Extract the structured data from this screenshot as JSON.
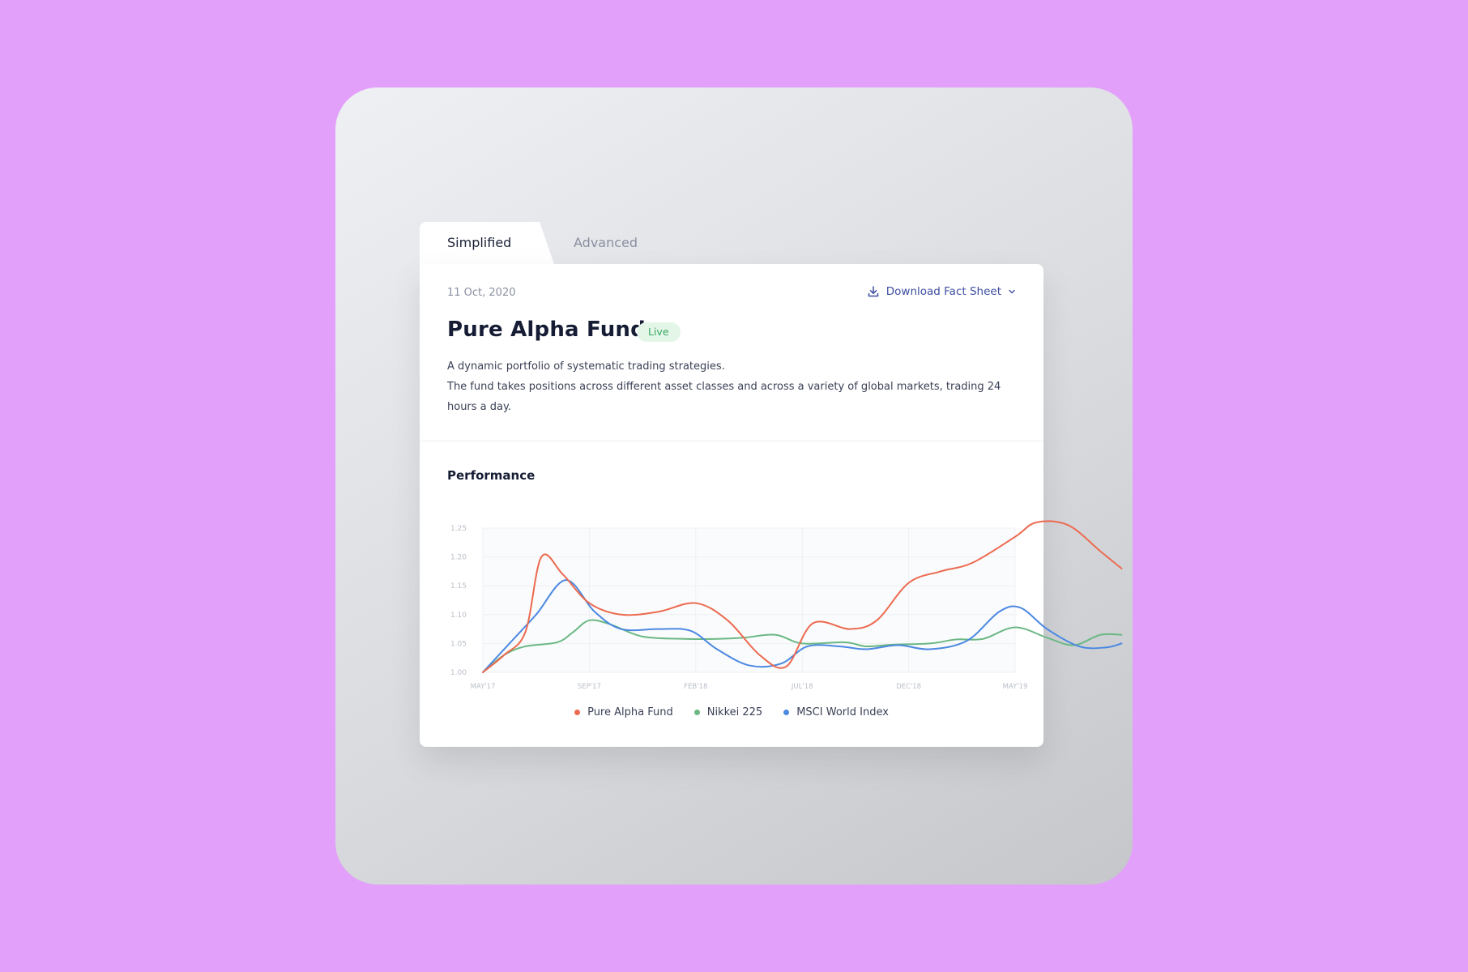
{
  "tabs": [
    {
      "label": "Simplified",
      "active": true
    },
    {
      "label": "Advanced",
      "active": false
    }
  ],
  "fund": {
    "date": "11 Oct, 2020",
    "download_label": "Download Fact Sheet",
    "title": "Pure Alpha Fund",
    "status": "Live",
    "description_line1": "A dynamic portfolio of systematic trading strategies.",
    "description_line2": "The fund takes positions across different asset classes and across a variety of global markets, trading 24 hours a day."
  },
  "performance": {
    "title": "Performance"
  },
  "colors": {
    "pure_alpha": "#ec6a4f",
    "nikkei": "#6bb884",
    "msci": "#4b88e2",
    "grid": "#eef0f3",
    "tick": "#b9bec8"
  },
  "chart_data": {
    "type": "line",
    "x": [
      "MAY'17",
      "SEP'17",
      "FEB'18",
      "JUL'18",
      "DEC'18",
      "MAY'19"
    ],
    "y_ticks": [
      "1.00",
      "1.05",
      "1.10",
      "1.15",
      "1.20",
      "1.25"
    ],
    "ylim": [
      1.0,
      1.25
    ],
    "grid": true,
    "legend": "bottom-center",
    "series": [
      {
        "name": "Pure Alpha Fund",
        "points": [
          [
            0,
            1.0
          ],
          [
            0.2,
            1.03
          ],
          [
            0.4,
            1.07
          ],
          [
            0.55,
            1.2
          ],
          [
            0.75,
            1.17
          ],
          [
            1.0,
            1.12
          ],
          [
            1.3,
            1.1
          ],
          [
            1.65,
            1.105
          ],
          [
            2.0,
            1.12
          ],
          [
            2.3,
            1.09
          ],
          [
            2.6,
            1.03
          ],
          [
            2.85,
            1.01
          ],
          [
            3.1,
            1.085
          ],
          [
            3.45,
            1.075
          ],
          [
            3.7,
            1.09
          ],
          [
            4.0,
            1.155
          ],
          [
            4.3,
            1.175
          ],
          [
            4.6,
            1.19
          ],
          [
            5.0,
            1.235
          ],
          [
            5.2,
            1.26
          ],
          [
            5.5,
            1.255
          ],
          [
            5.8,
            1.21
          ],
          [
            6.0,
            1.18
          ]
        ]
      },
      {
        "name": "Nikkei 225",
        "points": [
          [
            0,
            1.0
          ],
          [
            0.2,
            1.03
          ],
          [
            0.4,
            1.045
          ],
          [
            0.7,
            1.052
          ],
          [
            0.85,
            1.07
          ],
          [
            1.0,
            1.09
          ],
          [
            1.2,
            1.083
          ],
          [
            1.5,
            1.062
          ],
          [
            1.9,
            1.058
          ],
          [
            2.2,
            1.058
          ],
          [
            2.45,
            1.06
          ],
          [
            2.75,
            1.065
          ],
          [
            3.0,
            1.05
          ],
          [
            3.4,
            1.052
          ],
          [
            3.6,
            1.045
          ],
          [
            3.85,
            1.048
          ],
          [
            4.2,
            1.05
          ],
          [
            4.45,
            1.057
          ],
          [
            4.7,
            1.058
          ],
          [
            5.0,
            1.078
          ],
          [
            5.3,
            1.06
          ],
          [
            5.55,
            1.047
          ],
          [
            5.8,
            1.065
          ],
          [
            6.0,
            1.065
          ]
        ]
      },
      {
        "name": "MSCI World Index",
        "points": [
          [
            0,
            1.0
          ],
          [
            0.25,
            1.05
          ],
          [
            0.5,
            1.1
          ],
          [
            0.78,
            1.16
          ],
          [
            1.05,
            1.105
          ],
          [
            1.3,
            1.075
          ],
          [
            1.65,
            1.075
          ],
          [
            1.95,
            1.072
          ],
          [
            2.2,
            1.04
          ],
          [
            2.5,
            1.012
          ],
          [
            2.8,
            1.015
          ],
          [
            3.05,
            1.045
          ],
          [
            3.35,
            1.045
          ],
          [
            3.6,
            1.04
          ],
          [
            3.9,
            1.047
          ],
          [
            4.2,
            1.04
          ],
          [
            4.55,
            1.055
          ],
          [
            4.85,
            1.105
          ],
          [
            5.05,
            1.112
          ],
          [
            5.3,
            1.075
          ],
          [
            5.6,
            1.045
          ],
          [
            5.85,
            1.043
          ],
          [
            6.0,
            1.05
          ]
        ]
      }
    ]
  }
}
